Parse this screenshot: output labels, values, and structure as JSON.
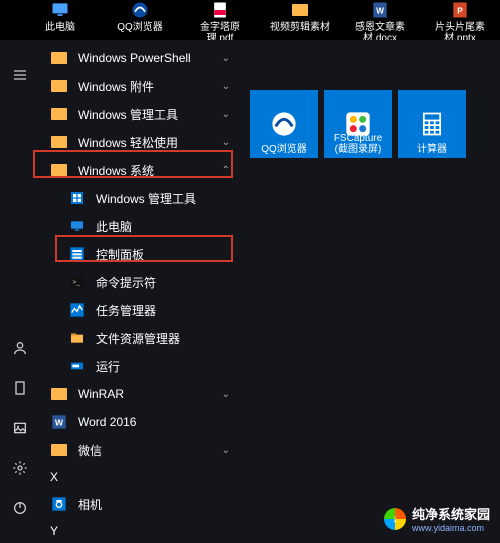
{
  "desktop": [
    {
      "label": "此电脑"
    },
    {
      "label": "QQ浏览器"
    },
    {
      "label": "金字塔原理.pdf"
    },
    {
      "label": "视频剪辑素材"
    },
    {
      "label": "感恩文章素材.docx"
    },
    {
      "label": "片头片尾素材.pptx"
    }
  ],
  "start": {
    "apps": [
      {
        "label": "Windows PowerShell",
        "kind": "folder",
        "chev": "down"
      },
      {
        "label": "Windows 附件",
        "kind": "folder",
        "chev": "down"
      },
      {
        "label": "Windows 管理工具",
        "kind": "folder",
        "chev": "down"
      },
      {
        "label": "Windows 轻松使用",
        "kind": "folder",
        "chev": "down"
      },
      {
        "label": "Windows 系统",
        "kind": "folder",
        "chev": "up"
      },
      {
        "label": "Windows 管理工具",
        "kind": "item-admintools",
        "indent": true
      },
      {
        "label": "此电脑",
        "kind": "item-thispc",
        "indent": true
      },
      {
        "label": "控制面板",
        "kind": "item-cpl",
        "indent": true
      },
      {
        "label": "命令提示符",
        "kind": "item-cmd",
        "indent": true
      },
      {
        "label": "任务管理器",
        "kind": "item-taskmgr",
        "indent": true
      },
      {
        "label": "文件资源管理器",
        "kind": "item-explorer",
        "indent": true
      },
      {
        "label": "运行",
        "kind": "item-run",
        "indent": true
      },
      {
        "label": "WinRAR",
        "kind": "folder",
        "chev": "down"
      },
      {
        "label": "Word 2016",
        "kind": "item-word"
      },
      {
        "label": "微信",
        "kind": "folder",
        "chev": "down"
      }
    ],
    "section_x": "X",
    "app_x": {
      "label": "相机"
    },
    "section_y": "Y"
  },
  "tiles": [
    {
      "label": "QQ浏览器",
      "kind": "qqbrowser"
    },
    {
      "label": "FSCapture (截图录屏)",
      "kind": "fscapture"
    },
    {
      "label": "计算器",
      "kind": "calculator"
    }
  ],
  "colors": {
    "tile_bg": "#0078d7",
    "panel_bg": "#14151a",
    "annotation": "#d23a2a"
  },
  "watermark": {
    "title": "纯净系统家园",
    "url": "www.yidaima.com"
  }
}
